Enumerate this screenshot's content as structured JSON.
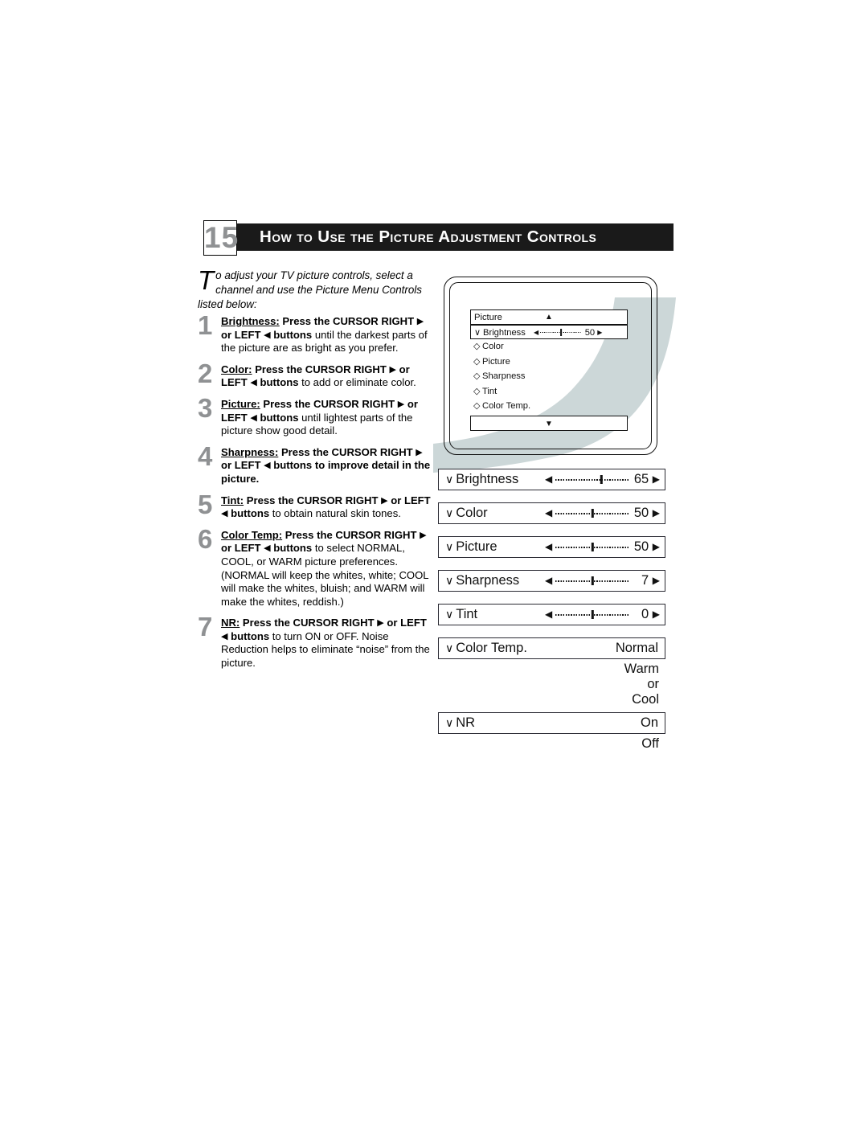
{
  "page": {
    "chapter_number": "15",
    "title": "How to Use the Picture Adjustment Controls",
    "intro_dropcap": "T",
    "intro_text": "o adjust your TV picture controls, select a channel and use the Picture Menu Controls listed below:"
  },
  "colors": {
    "header_bar": "#1a1a1a",
    "number_gray": "#8f9193",
    "swoosh": "#ccd7d8",
    "bar_border": "#2a2a33"
  },
  "steps": [
    {
      "num": "1",
      "term": "Brightness:",
      "bold_lead": "Press the CURSOR RIGHT",
      "arrow_right": "▶",
      "bold_mid": "or LEFT",
      "arrow_left": "◀",
      "bold_tail": "buttons",
      "rest": "until the darkest parts of the picture are as bright as you prefer."
    },
    {
      "num": "2",
      "term": "Color:",
      "bold_lead": "Press the CURSOR RIGHT",
      "arrow_right": "▶",
      "bold_mid": "or LEFT",
      "arrow_left": "◀",
      "bold_tail": "buttons",
      "rest": "to add or eliminate color."
    },
    {
      "num": "3",
      "term": "Picture:",
      "bold_lead": "Press the CURSOR RIGHT",
      "arrow_right": "▶",
      "bold_mid": "or LEFT",
      "arrow_left": "◀",
      "bold_tail": "buttons",
      "rest": "until lightest parts of the   picture show good detail."
    },
    {
      "num": "4",
      "term": "Sharpness:",
      "bold_lead": "Press the CURSOR RIGHT",
      "arrow_right": "▶",
      "bold_mid": "or LEFT",
      "arrow_left": "◀",
      "bold_tail": "buttons to improve detail in the picture.",
      "rest": ""
    },
    {
      "num": "5",
      "term": "Tint:",
      "bold_lead": "Press the CURSOR RIGHT",
      "arrow_right": "▶",
      "bold_mid": "or LEFT",
      "arrow_left": "◀",
      "bold_tail": "buttons",
      "rest": "to obtain natural skin tones."
    },
    {
      "num": "6",
      "term": "Color Temp:",
      "bold_lead": "Press the CURSOR RIGHT",
      "arrow_right": "▶",
      "bold_mid": "or LEFT",
      "arrow_left": "◀",
      "bold_tail": "buttons",
      "rest": "to select NORMAL, COOL, or WARM picture preferences. (NORMAL will keep the whites, white; COOL will make the whites, bluish; and WARM will make the whites, reddish.)"
    },
    {
      "num": "7",
      "term": "NR:",
      "bold_lead": "Press the CURSOR RIGHT",
      "arrow_right": "▶",
      "bold_mid": "or LEFT",
      "arrow_left": "◀",
      "bold_tail": "buttons",
      "rest": "to turn ON or OFF. Noise Reduction helps to eliminate “noise” from the picture."
    }
  ],
  "tv_osd": {
    "header_label": "Picture",
    "header_caret": "▲",
    "footer_caret": "▼",
    "active_mark": "∨",
    "inactive_mark": "◇",
    "rows": [
      {
        "label": "Brightness",
        "active": true,
        "value": "50"
      },
      {
        "label": "Color",
        "active": false,
        "value": ""
      },
      {
        "label": "Picture",
        "active": false,
        "value": ""
      },
      {
        "label": "Sharpness",
        "active": false,
        "value": ""
      },
      {
        "label": "Tint",
        "active": false,
        "value": ""
      },
      {
        "label": "Color Temp.",
        "active": false,
        "value": ""
      }
    ]
  },
  "bars": {
    "check_mark": "∨",
    "tri_left": "◀",
    "tri_right": "▶",
    "items": [
      {
        "label": "Brightness",
        "type": "slider",
        "value": "65",
        "knob_pct": 62
      },
      {
        "label": "Color",
        "type": "slider",
        "value": "50",
        "knob_pct": 50
      },
      {
        "label": "Picture",
        "type": "slider",
        "value": "50",
        "knob_pct": 50
      },
      {
        "label": "Sharpness",
        "type": "slider",
        "value": "7",
        "knob_pct": 50
      },
      {
        "label": "Tint",
        "type": "slider",
        "value": "0",
        "knob_pct": 50
      },
      {
        "label": "Color Temp.",
        "type": "option",
        "value": "Normal",
        "extra": [
          "Warm",
          "or",
          "Cool"
        ]
      },
      {
        "label": "NR",
        "type": "option",
        "value": "On",
        "extra": [
          "Off"
        ]
      }
    ]
  }
}
